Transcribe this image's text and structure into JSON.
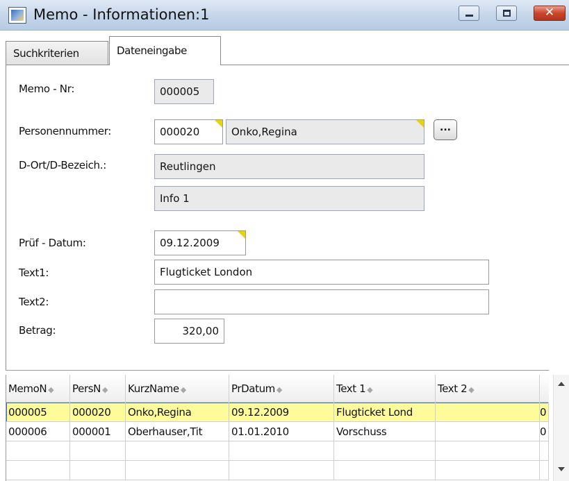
{
  "window": {
    "title": "Memo - Informationen:1",
    "close_glyph": "✕"
  },
  "tabs": [
    {
      "label": "Suchkriterien"
    },
    {
      "label": "Dateneingabe"
    }
  ],
  "form": {
    "memo_nr": {
      "label": "Memo - Nr:",
      "value": "000005"
    },
    "personennummer": {
      "label": "Personennummer:",
      "number": "000020",
      "name": "Onko,Regina",
      "lookup_label": "..."
    },
    "ort_bezeichnung": {
      "label": "D-Ort/D-Bezeich.:",
      "ort": "Reutlingen",
      "bezeichnung": "Info 1"
    },
    "pruef_datum": {
      "label": "Prüf - Datum:",
      "value": "09.12.2009"
    },
    "text1": {
      "label": "Text1:",
      "value": "Flugticket London"
    },
    "text2": {
      "label": "Text2:",
      "value": ""
    },
    "betrag": {
      "label": "Betrag:",
      "value": "320,00"
    }
  },
  "grid": {
    "columns": [
      "MemoN",
      "PersN",
      "KurzName",
      "PrDatum",
      "Text 1",
      "Text 2",
      ""
    ],
    "sort_glyph": "◆",
    "rows": [
      {
        "cells": [
          "000005",
          "000020",
          "Onko,Regina",
          "09.12.2009",
          "Flugticket Lond",
          "",
          "0"
        ]
      },
      {
        "cells": [
          "000006",
          "000001",
          "Oberhauser,Tit",
          "01.01.2010",
          "Vorschuss",
          "",
          "0"
        ]
      },
      {
        "cells": [
          "",
          "",
          "",
          "",
          "",
          "",
          ""
        ]
      },
      {
        "cells": [
          "",
          "",
          "",
          "",
          "",
          "",
          ""
        ]
      }
    ]
  },
  "colors": {
    "selected_row": "#fdfb9a",
    "title_bar": "#c6d6ea",
    "required_marker": "#e8d400"
  }
}
